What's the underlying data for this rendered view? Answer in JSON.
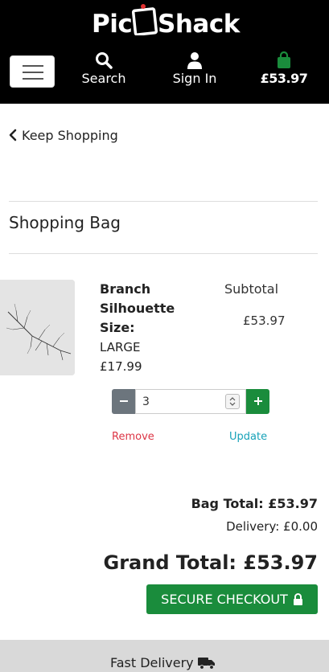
{
  "brand": {
    "part1": "Pic",
    "part2": "Shack"
  },
  "nav": {
    "search_label": "Search",
    "signin_label": "Sign In",
    "bag_total": "£53.97"
  },
  "keep_shopping": "Keep Shopping",
  "page_title": "Shopping Bag",
  "item": {
    "name": "Branch Silhouette",
    "size_label": "Size:",
    "size_value": "LARGE",
    "price": "£17.99",
    "subtotal_label": "Subtotal",
    "subtotal_value": "£53.97",
    "quantity": "3",
    "remove_label": "Remove",
    "update_label": "Update"
  },
  "totals": {
    "bag_total": "Bag Total: £53.97",
    "delivery": "Delivery: £0.00",
    "grand_total": "Grand Total: £53.97"
  },
  "checkout_label": "SECURE CHECKOUT",
  "footer": {
    "fast_delivery": "Fast Delivery"
  },
  "colors": {
    "header_bg": "#000000",
    "accent_green": "#1a8c3c",
    "remove_red": "#dc3545",
    "update_teal": "#17a2b8"
  }
}
